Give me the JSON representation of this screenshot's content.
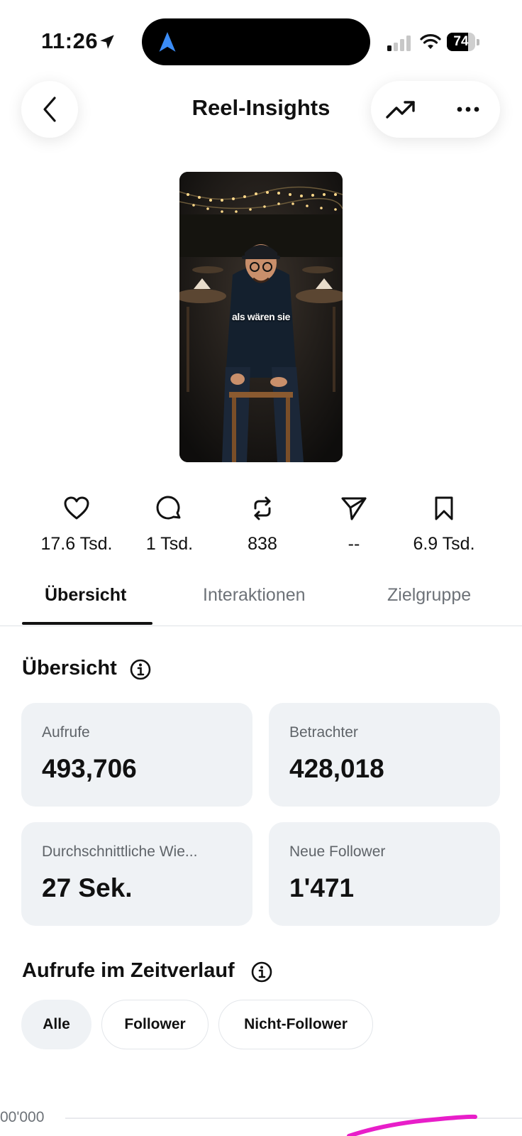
{
  "status_bar": {
    "time": "11:26",
    "battery_level": 74,
    "battery_label": "74"
  },
  "header": {
    "title": "Reel-Insights"
  },
  "reel": {
    "caption": "als wären sie"
  },
  "metrics": {
    "likes": "17.6 Tsd.",
    "comments": "1 Tsd.",
    "reposts": "838",
    "shares": "--",
    "saves": "6.9 Tsd."
  },
  "tabs": [
    {
      "label": "Übersicht",
      "active": true
    },
    {
      "label": "Interaktionen",
      "active": false
    },
    {
      "label": "Zielgruppe",
      "active": false
    }
  ],
  "overview": {
    "title": "Übersicht",
    "cards": [
      {
        "label": "Aufrufe",
        "value": "493,706"
      },
      {
        "label": "Betrachter",
        "value": "428,018"
      },
      {
        "label": "Durchschnittliche Wie...",
        "value": "27 Sek."
      },
      {
        "label": "Neue Follower",
        "value": "1'471"
      }
    ]
  },
  "views_over_time": {
    "title": "Aufrufe im Zeitverlauf",
    "filters": [
      {
        "label": "Alle",
        "selected": true
      },
      {
        "label": "Follower",
        "selected": false
      },
      {
        "label": "Nicht-Follower",
        "selected": false
      }
    ],
    "y_tick_label": "00'000"
  },
  "colors": {
    "accent_line": "#e81ec9",
    "card_bg": "#eff2f5",
    "muted_text": "#6d7278",
    "nav_arrow": "#3b8cf6"
  }
}
